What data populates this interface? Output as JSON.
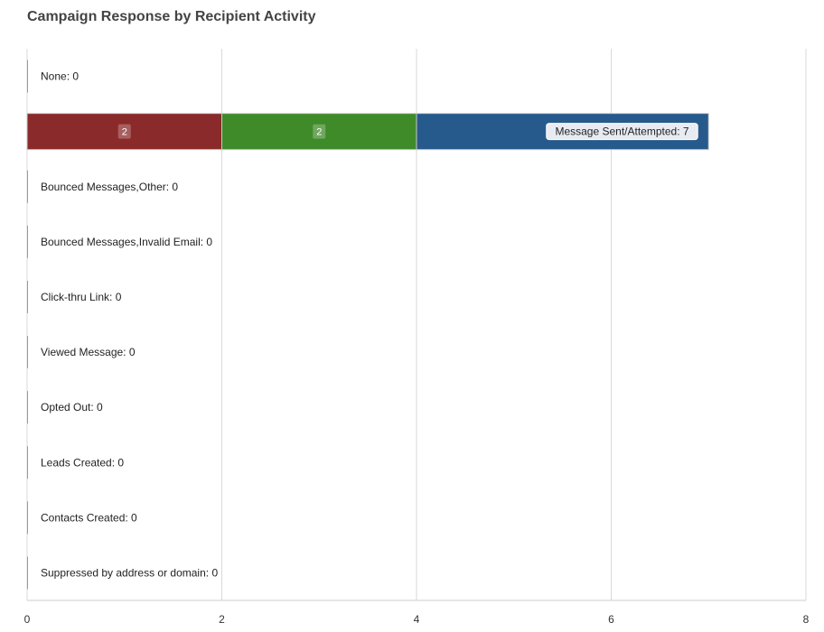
{
  "chart_data": {
    "type": "bar",
    "orientation": "horizontal",
    "stacked": true,
    "title": "Campaign Response by Recipient Activity",
    "xlabel": "",
    "ylabel": "",
    "xlim": [
      0,
      8
    ],
    "x_ticks": [
      0,
      2,
      4,
      6,
      8
    ],
    "grid": true,
    "categories": [
      "None",
      "Message Sent/Attempted",
      "Bounced Messages,Other",
      "Bounced Messages,Invalid Email",
      "Click-thru Link",
      "Viewed Message",
      "Opted Out",
      "Leads Created",
      "Contacts Created",
      "Suppressed by address or domain"
    ],
    "row_labels": [
      "None: 0",
      "Message Sent/Attempted: 7",
      "Bounced Messages,Other: 0",
      "Bounced Messages,Invalid Email: 0",
      "Click-thru Link: 0",
      "Viewed Message: 0",
      "Opted Out: 0",
      "Leads Created: 0",
      "Contacts Created: 0",
      "Suppressed by address or domain: 0"
    ],
    "series": [
      {
        "color": "#8b2a2a",
        "values": [
          0,
          2,
          0,
          0,
          0,
          0,
          0,
          0,
          0,
          0
        ],
        "labels": [
          "",
          "2",
          "",
          "",
          "",
          "",
          "",
          "",
          "",
          ""
        ]
      },
      {
        "color": "#3f8a29",
        "values": [
          0,
          2,
          0,
          0,
          0,
          0,
          0,
          0,
          0,
          0
        ],
        "labels": [
          "",
          "2",
          "",
          "",
          "",
          "",
          "",
          "",
          "",
          ""
        ]
      },
      {
        "color": "#275a8c",
        "values": [
          0,
          3,
          0,
          0,
          0,
          0,
          0,
          0,
          0,
          0
        ],
        "labels": [
          "",
          "",
          "",
          "",
          "",
          "",
          "",
          "",
          "",
          ""
        ]
      }
    ]
  }
}
